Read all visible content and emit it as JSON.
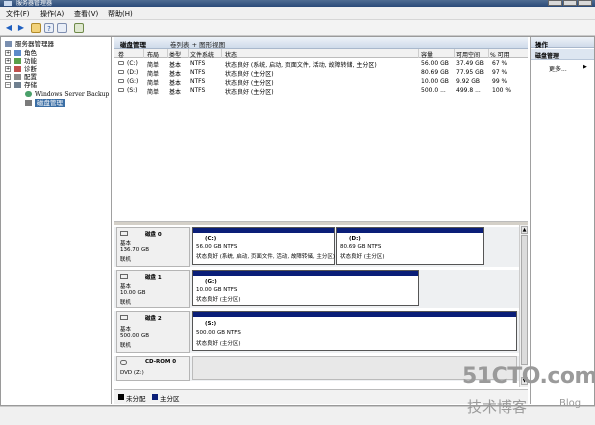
{
  "window": {
    "title": "服务器管理器"
  },
  "menu": [
    "文件(F)",
    "操作(A)",
    "查看(V)",
    "帮助(H)"
  ],
  "toolbar": [
    "back-icon",
    "forward-icon",
    "up-folder-icon",
    "help-icon",
    "properties-icon",
    "refresh-icon"
  ],
  "tree": {
    "root": "服务器管理器",
    "items": [
      {
        "label": "角色",
        "icon": "roles-icon",
        "expand": "+"
      },
      {
        "label": "功能",
        "icon": "features-icon",
        "expand": "+"
      },
      {
        "label": "诊断",
        "icon": "diagnostics-icon",
        "expand": "+"
      },
      {
        "label": "配置",
        "icon": "configuration-icon",
        "expand": "+"
      },
      {
        "label": "存储",
        "icon": "storage-icon",
        "expand": "−"
      }
    ],
    "storage_children": [
      "Windows Server Backup",
      "磁盘管理"
    ]
  },
  "center": {
    "title": "磁盘管理",
    "subtitle": "卷列表 + 图形视图",
    "columns": [
      "卷",
      "布局",
      "类型",
      "文件系统",
      "状态",
      "容量",
      "可用空间",
      "% 可用"
    ],
    "volumes": [
      {
        "vol": "(C:)",
        "layout": "简单",
        "type": "基本",
        "fs": "NTFS",
        "status": "状态良好 (系统, 启动, 页面文件, 活动, 故障转储, 主分区)",
        "capacity": "56.00 GB",
        "free": "37.49 GB",
        "pct": "67 %"
      },
      {
        "vol": "(D:)",
        "layout": "简单",
        "type": "基本",
        "fs": "NTFS",
        "status": "状态良好 (主分区)",
        "capacity": "80.69 GB",
        "free": "77.95 GB",
        "pct": "97 %"
      },
      {
        "vol": "(G:)",
        "layout": "简单",
        "type": "基本",
        "fs": "NTFS",
        "status": "状态良好 (主分区)",
        "capacity": "10.00 GB",
        "free": "9.92 GB",
        "pct": "99 %"
      },
      {
        "vol": "(S:)",
        "layout": "简单",
        "type": "基本",
        "fs": "NTFS",
        "status": "状态良好 (主分区)",
        "capacity": "500.0 ...",
        "free": "499.8 ...",
        "pct": "100 %"
      }
    ]
  },
  "disks": [
    {
      "name": "磁盘 0",
      "type": "基本",
      "size": "136.70 GB",
      "state": "联机",
      "partitions": [
        {
          "label": "(C:)",
          "size": "56.00 GB NTFS",
          "status": "状态良好 (系统, 启动, 页面文件, 活动, 故障转储, 主分区)"
        },
        {
          "label": "(D:)",
          "size": "80.69 GB NTFS",
          "status": "状态良好 (主分区)"
        }
      ]
    },
    {
      "name": "磁盘 1",
      "type": "基本",
      "size": "10.00 GB",
      "state": "联机",
      "partitions": [
        {
          "label": "(G:)",
          "size": "10.00 GB NTFS",
          "status": "状态良好 (主分区)"
        }
      ]
    },
    {
      "name": "磁盘 2",
      "type": "基本",
      "size": "500.00 GB",
      "state": "联机",
      "partitions": [
        {
          "label": "(S:)",
          "size": "500.00 GB NTFS",
          "status": "状态良好 (主分区)"
        }
      ]
    },
    {
      "name": "CD-ROM 0",
      "type": "DVD (Z:)",
      "size": "",
      "state": "",
      "partitions": []
    }
  ],
  "legend": [
    {
      "label": "未分配",
      "color": "#000000"
    },
    {
      "label": "主分区",
      "color": "#0a1e78"
    }
  ],
  "actions": {
    "header": "操作",
    "section": "磁盘管理",
    "more": "更多..."
  },
  "watermark": {
    "line1": "51CTO.com",
    "line2": "技术博客",
    "line3": "Blog"
  },
  "colors": {
    "primary_partition": "#0a1e78",
    "unallocated": "#000000",
    "header": "#cfdbea"
  }
}
